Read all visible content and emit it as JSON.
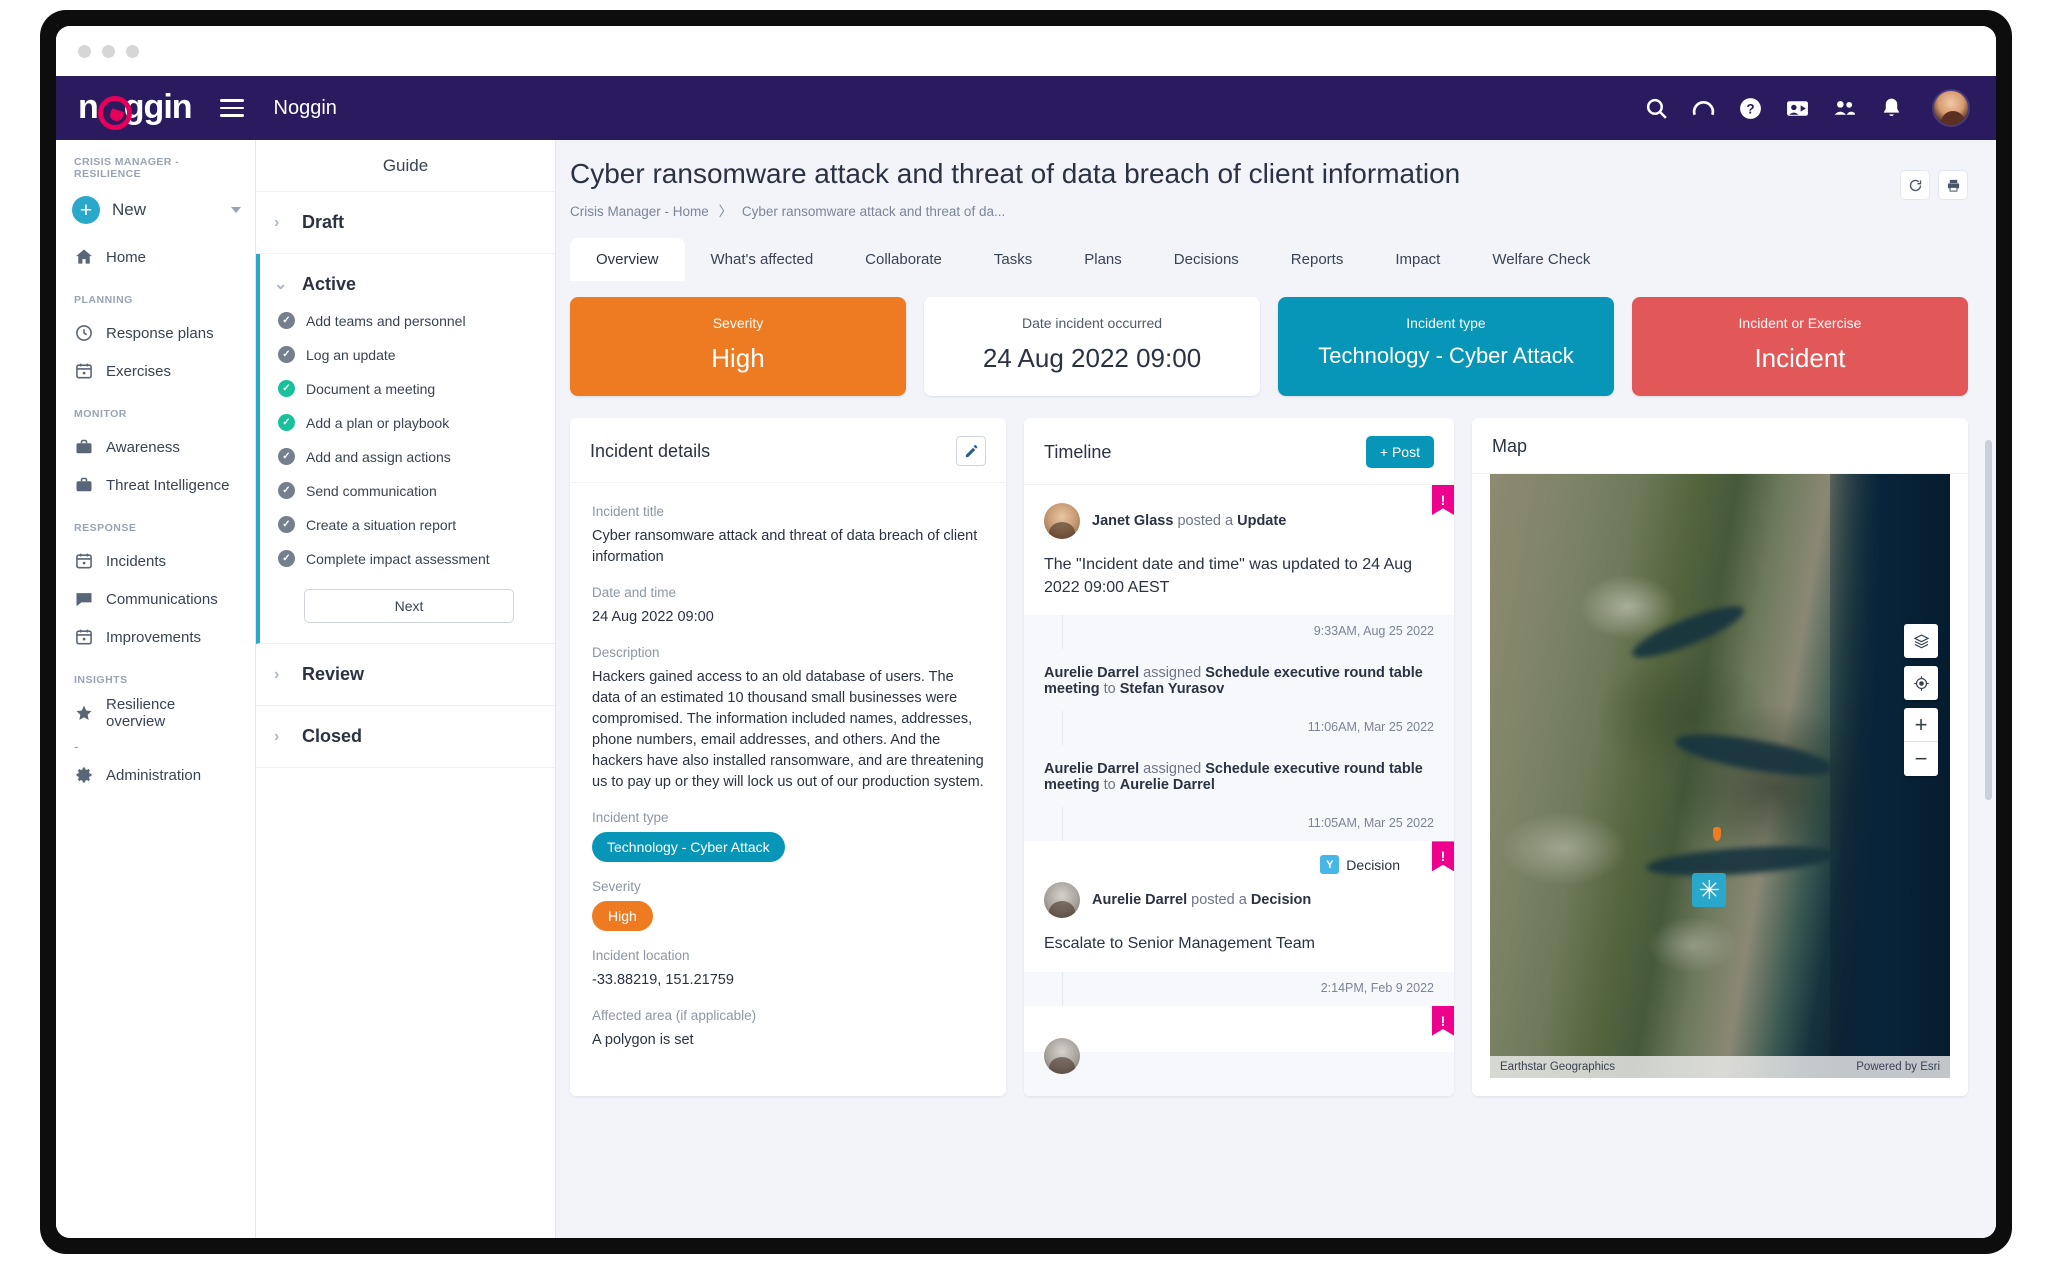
{
  "window": {
    "dots": 3
  },
  "topbar": {
    "logo_text": "n",
    "logo_text_2": "ggin",
    "app_name": "Noggin",
    "icons": [
      {
        "name": "search-icon"
      },
      {
        "name": "history-icon"
      },
      {
        "name": "help-icon"
      },
      {
        "name": "contact-card-icon"
      },
      {
        "name": "people-icon"
      },
      {
        "name": "notifications-bell-icon"
      }
    ]
  },
  "sidebar": {
    "workspace_label": "CRISIS MANAGER - RESILIENCE",
    "new_label": "New",
    "home_label": "Home",
    "sections": [
      {
        "label": "PLANNING",
        "items": [
          {
            "label": "Response plans",
            "icon": "clock-icon"
          },
          {
            "label": "Exercises",
            "icon": "calendar-icon"
          }
        ]
      },
      {
        "label": "MONITOR",
        "items": [
          {
            "label": "Awareness",
            "icon": "briefcase-icon"
          },
          {
            "label": "Threat Intelligence",
            "icon": "briefcase-icon"
          }
        ]
      },
      {
        "label": "RESPONSE",
        "items": [
          {
            "label": "Incidents",
            "icon": "calendar-icon"
          },
          {
            "label": "Communications",
            "icon": "chat-icon"
          },
          {
            "label": "Improvements",
            "icon": "calendar-icon"
          }
        ]
      },
      {
        "label": "INSIGHTS",
        "items": [
          {
            "label": "Resilience overview",
            "icon": "star-icon"
          }
        ]
      }
    ],
    "divider_dash": "-",
    "admin_label": "Administration"
  },
  "guide": {
    "title": "Guide",
    "draft_label": "Draft",
    "active_label": "Active",
    "review_label": "Review",
    "closed_label": "Closed",
    "next_label": "Next",
    "tasks": [
      {
        "label": "Add teams and personnel",
        "state": "grey"
      },
      {
        "label": "Log an update",
        "state": "grey"
      },
      {
        "label": "Document a meeting",
        "state": "green"
      },
      {
        "label": "Add a plan or playbook",
        "state": "green"
      },
      {
        "label": "Add and assign actions",
        "state": "grey"
      },
      {
        "label": "Send communication",
        "state": "grey"
      },
      {
        "label": "Create a situation report",
        "state": "grey"
      },
      {
        "label": "Complete impact assessment",
        "state": "grey"
      }
    ]
  },
  "header": {
    "title": "Cyber ransomware attack and threat of data breach of client information",
    "breadcrumb_root": "Crisis Manager - Home",
    "breadcrumb_sep": "〉",
    "breadcrumb_current": "Cyber ransomware attack and threat of da...",
    "refresh_icon": "refresh-icon",
    "print_icon": "print-icon"
  },
  "tabs": [
    {
      "label": "Overview",
      "selected": true
    },
    {
      "label": "What's affected",
      "selected": false
    },
    {
      "label": "Collaborate",
      "selected": false
    },
    {
      "label": "Tasks",
      "selected": false
    },
    {
      "label": "Plans",
      "selected": false
    },
    {
      "label": "Decisions",
      "selected": false
    },
    {
      "label": "Reports",
      "selected": false
    },
    {
      "label": "Impact",
      "selected": false
    },
    {
      "label": "Welfare Check",
      "selected": false
    }
  ],
  "kpis": [
    {
      "label": "Severity",
      "value": "High",
      "color": "#ee7b22"
    },
    {
      "label": "Date incident occurred",
      "value": "24 Aug 2022 09:00",
      "color": "#ffffff"
    },
    {
      "label": "Incident type",
      "value": "Technology - Cyber Attack",
      "color": "#0896b8"
    },
    {
      "label": "Incident or Exercise",
      "value": "Incident",
      "color": "#e25757"
    }
  ],
  "details": {
    "panel_title": "Incident details",
    "edit_icon": "pencil-icon",
    "title_label": "Incident title",
    "title_value": "Cyber ransomware attack and threat of data breach of client information",
    "datetime_label": "Date and time",
    "datetime_value": "24 Aug 2022 09:00",
    "description_label": "Description",
    "description_value": "Hackers gained access to an old database of users. The data of an estimated 10 thousand small businesses were compromised. The information included names, addresses, phone numbers, email addresses, and others. And the hackers have also installed ransomware, and are threatening us to pay up or they will lock us out of our production system.",
    "type_label": "Incident type",
    "type_value": "Technology - Cyber Attack",
    "severity_label": "Severity",
    "severity_value": "High",
    "location_label": "Incident location",
    "location_value": "-33.88219, 151.21759",
    "area_label": "Affected area (if applicable)",
    "area_value": "A polygon is set"
  },
  "timeline": {
    "panel_title": "Timeline",
    "post_label": "+ Post",
    "events": [
      {
        "kind": "update",
        "actor": "Janet Glass",
        "verb": "posted a",
        "object": "Update",
        "text": "The \"Incident date and time\" was updated to 24 Aug 2022 09:00 AEST",
        "time": "9:33AM, Aug 25 2022",
        "flag": "!"
      },
      {
        "kind": "assignment",
        "actor": "Aurelie Darrel",
        "verb": "assigned",
        "object": "Schedule executive round table meeting",
        "to_label": "to",
        "assignee": "Stefan Yurasov",
        "time": "11:06AM, Mar 25 2022"
      },
      {
        "kind": "assignment",
        "actor": "Aurelie Darrel",
        "verb": "assigned",
        "object": "Schedule executive round table meeting",
        "to_label": "to",
        "assignee": "Aurelie Darrel",
        "time": "11:05AM, Mar 25 2022"
      },
      {
        "kind": "decision",
        "tag": "Decision",
        "actor": "Aurelie Darrel",
        "verb": "posted a",
        "object": "Decision",
        "text": "Escalate to Senior Management Team",
        "time": "2:14PM, Feb 9 2022",
        "flag": "!"
      }
    ]
  },
  "map": {
    "panel_title": "Map",
    "attribution_left": "Earthstar Geographics",
    "attribution_right": "Powered by Esri",
    "controls": [
      {
        "name": "layers-icon"
      },
      {
        "name": "locate-icon"
      }
    ],
    "zoom_in": "+",
    "zoom_out": "−",
    "marker_icon": "incident-marker-icon"
  }
}
